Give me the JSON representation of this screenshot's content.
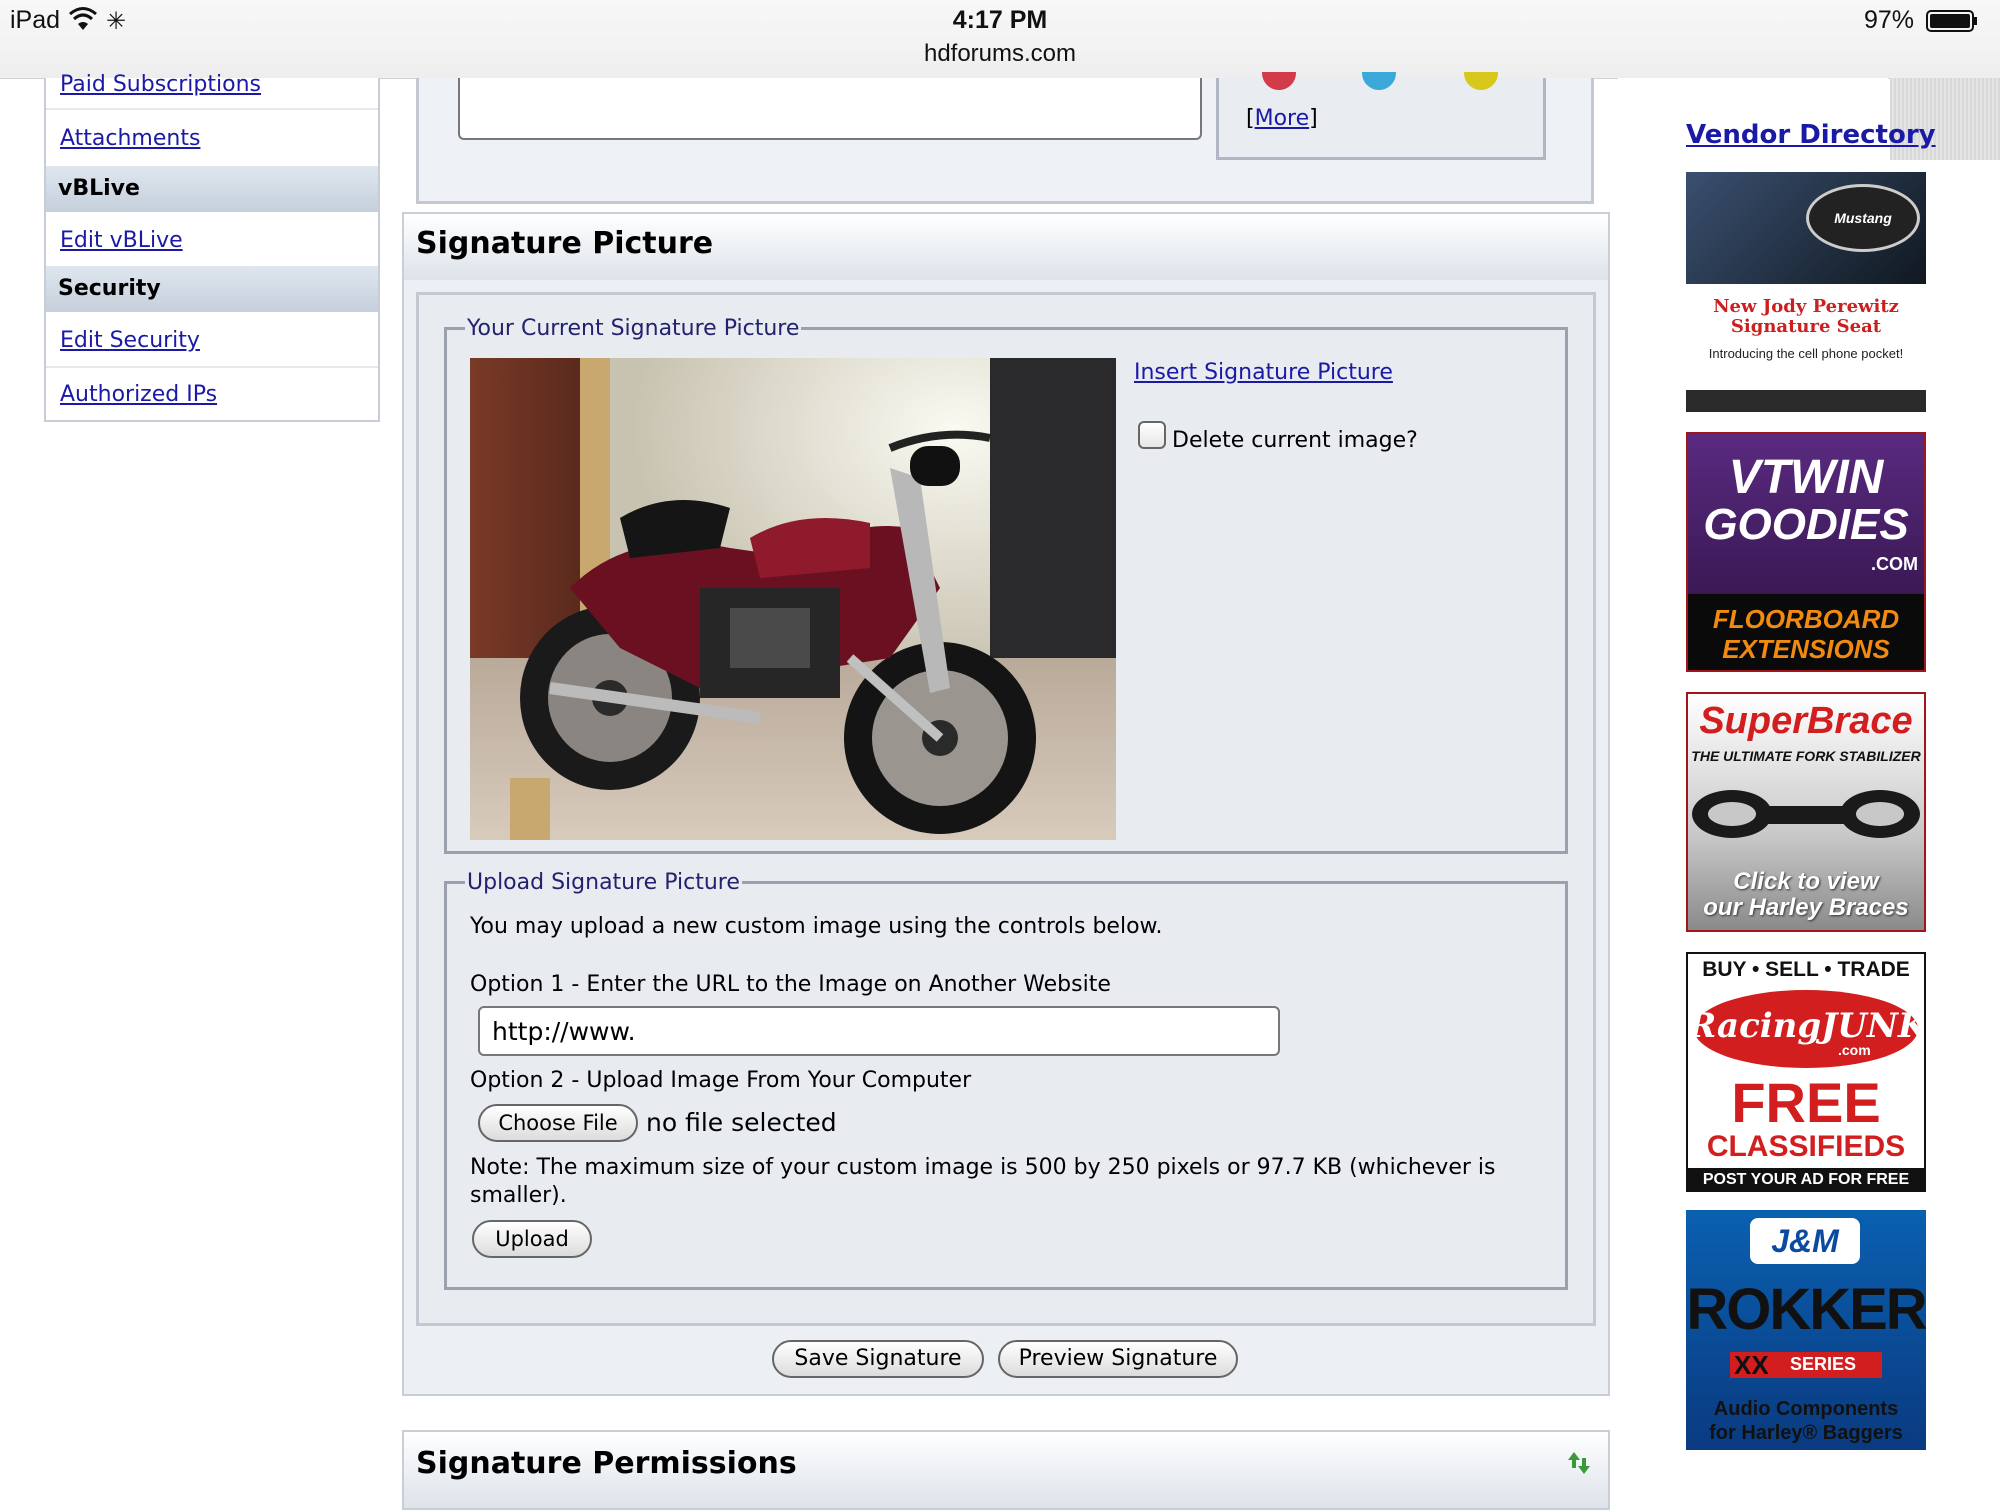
{
  "status_bar": {
    "device": "iPad",
    "time": "4:17 PM",
    "url": "hdforums.com",
    "battery": "97%"
  },
  "left_nav": {
    "links_top": [
      "Paid Subscriptions",
      "Attachments"
    ],
    "section_vblive": "vBLive",
    "edit_vblive": "Edit vBLive",
    "section_security": "Security",
    "edit_security": "Edit Security",
    "authorized_ips": "Authorized IPs"
  },
  "top_box": {
    "more_open": "[",
    "more_label": "More",
    "more_close": "]"
  },
  "signature_picture": {
    "title": "Signature Picture",
    "current_legend": "Your Current Signature Picture",
    "insert_link": "Insert Signature Picture",
    "delete_label": "Delete current image?",
    "upload_legend": "Upload Signature Picture",
    "upload_intro": "You may upload a new custom image using the controls below.",
    "option1_label": "Option 1 - Enter the URL to the Image on Another Website",
    "url_value": "http://www.",
    "option2_label": "Option 2 - Upload Image From Your Computer",
    "choose_file": "Choose File",
    "no_file": "no file selected",
    "note": "Note: The maximum size of your custom image is 500 by 250 pixels or 97.7 KB (whichever is smaller).",
    "upload_button": "Upload"
  },
  "actions": {
    "save": "Save Signature",
    "preview": "Preview Signature"
  },
  "permissions": {
    "title": "Signature Permissions"
  },
  "right_ads": {
    "vendor_directory": "Vendor Directory",
    "ad1": {
      "brand": "Mustang",
      "line1": "New Jody Perewitz",
      "line2": "Signature Seat",
      "line3": "Introducing the cell phone pocket!"
    },
    "ad2": {
      "line1": "VTWIN",
      "line2": "GOODIES",
      "line3": ".COM",
      "line4": "FLOORBOARD",
      "line5": "EXTENSIONS"
    },
    "ad3": {
      "line1": "SuperBrace",
      "line2": "THE ULTIMATE FORK STABILIZER",
      "line3": "Click to view",
      "line4": "our Harley Braces"
    },
    "ad4": {
      "line1": "BUY • SELL • TRADE",
      "line2": "RacingJUNK",
      "line3": ".com",
      "line4": "FREE",
      "line5": "CLASSIFIEDS",
      "line6": "POST YOUR AD FOR FREE"
    },
    "ad5": {
      "brand": "J&M",
      "line1": "ROKKER",
      "line2": "XX",
      "line3": "SERIES",
      "line4": "Audio Components",
      "line5": "for Harley® Baggers"
    }
  },
  "colors": {
    "link": "#1a1aa6",
    "legend": "#22226e",
    "panel_bg": "#eceff3"
  }
}
